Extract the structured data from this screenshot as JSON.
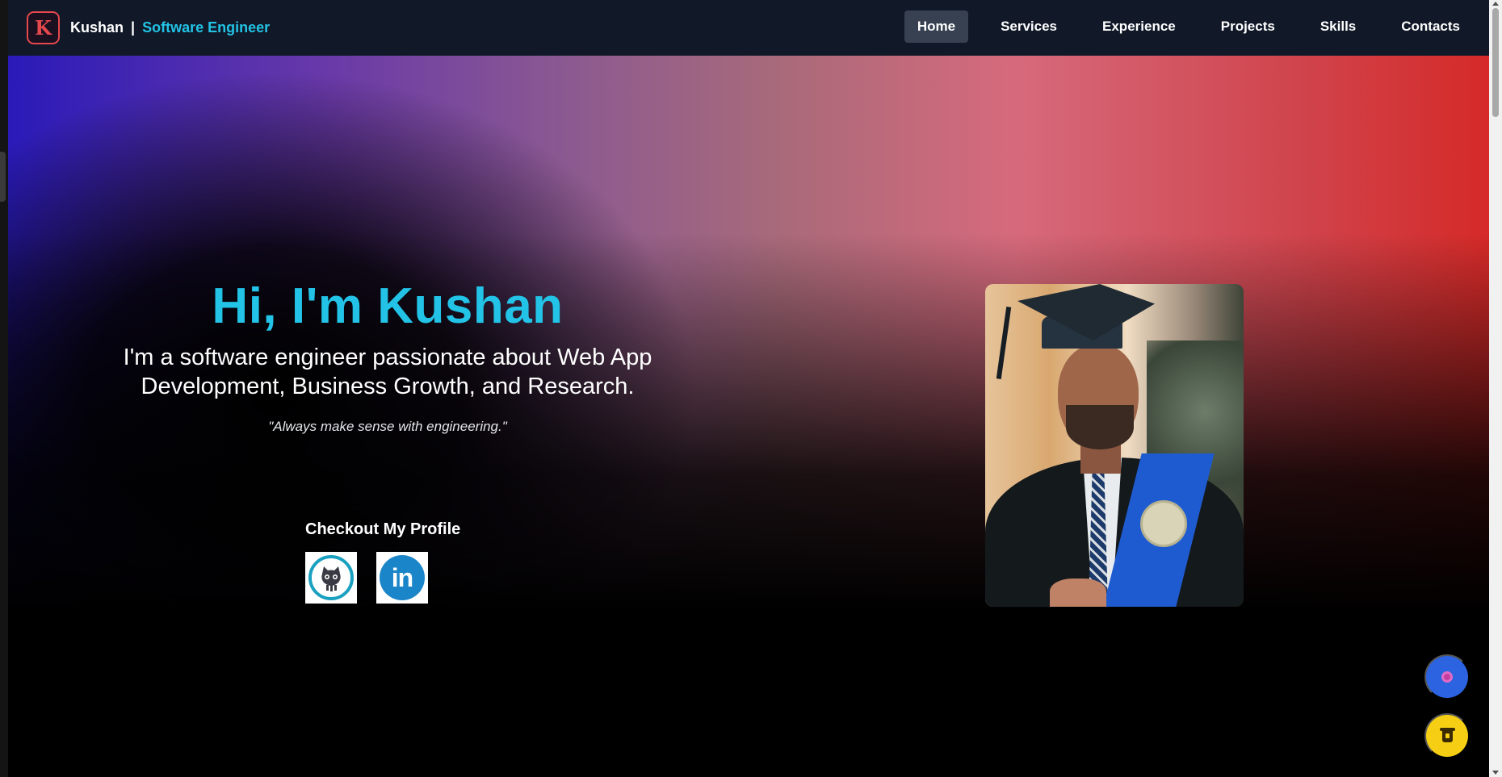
{
  "brand": {
    "logo_letter": "K",
    "name": "Kushan",
    "separator": "|",
    "role": "Software Engineer"
  },
  "nav": {
    "items": [
      {
        "label": "Home",
        "active": true
      },
      {
        "label": "Services",
        "active": false
      },
      {
        "label": "Experience",
        "active": false
      },
      {
        "label": "Projects",
        "active": false
      },
      {
        "label": "Skills",
        "active": false
      },
      {
        "label": "Contacts",
        "active": false
      }
    ]
  },
  "hero": {
    "title": "Hi, I'm Kushan",
    "subtitle_line1": "I'm a software engineer passionate about Web App",
    "subtitle_line2": "Development, Business Growth, and Research.",
    "quote": "\"Always make sense with engineering.\""
  },
  "profile": {
    "heading": "Checkout My Profile",
    "links": [
      {
        "icon": "github-icon"
      },
      {
        "icon": "linkedin-icon",
        "text": "in"
      }
    ]
  },
  "portrait": {
    "icon": "graduation-portrait-photo"
  },
  "floating": {
    "settings_icon": "gear-icon",
    "coffee_icon": "coffee-cup-icon"
  },
  "colors": {
    "accent": "#22c3e6",
    "navbar": "#111827",
    "nav_active": "#374151",
    "logo": "#e5484d",
    "fab_settings": "#2b63e0",
    "fab_coffee": "#f6cf15"
  }
}
